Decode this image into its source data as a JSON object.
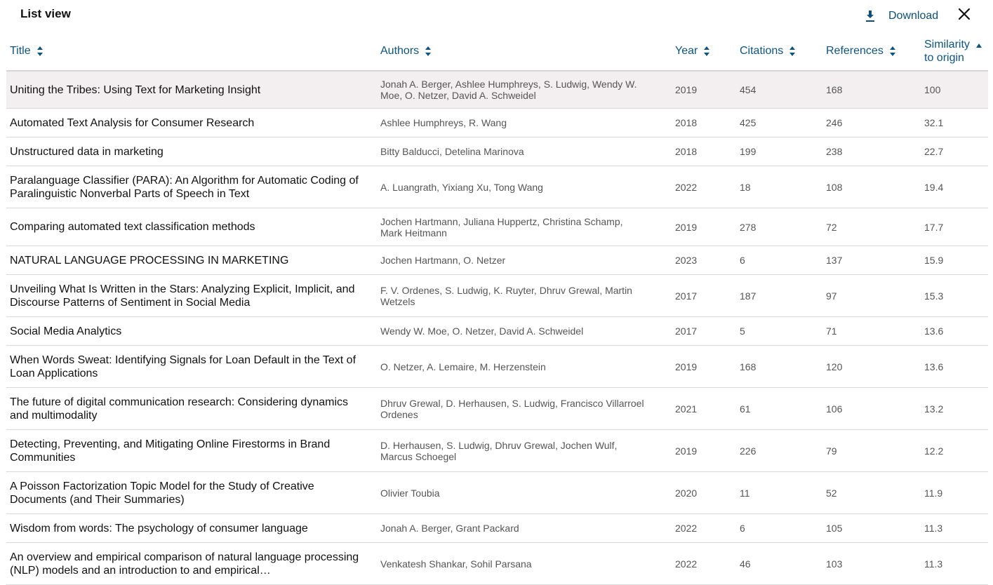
{
  "header": {
    "title": "List view",
    "download_label": "Download",
    "accent": "#0b5484"
  },
  "columns": {
    "title": "Title",
    "authors": "Authors",
    "year": "Year",
    "citations": "Citations",
    "references": "References",
    "similarity_line1": "Similarity",
    "similarity_line2": "to origin"
  },
  "rows": [
    {
      "title": "Uniting the Tribes: Using Text for Marketing Insight",
      "authors": "Jonah A. Berger, Ashlee Humphreys, S. Ludwig, Wendy W. Moe, O. Netzer, David A. Schweidel",
      "year": "2019",
      "citations": "454",
      "references": "168",
      "similarity": "100"
    },
    {
      "title": "Automated Text Analysis for Consumer Research",
      "authors": "Ashlee Humphreys, R. Wang",
      "year": "2018",
      "citations": "425",
      "references": "246",
      "similarity": "32.1"
    },
    {
      "title": "Unstructured data in marketing",
      "authors": "Bitty Balducci, Detelina Marinova",
      "year": "2018",
      "citations": "199",
      "references": "238",
      "similarity": "22.7"
    },
    {
      "title": "Paralanguage Classifier (PARA): An Algorithm for Automatic Coding of Paralinguistic Nonverbal Parts of Speech in Text",
      "authors": "A. Luangrath, Yixiang Xu, Tong Wang",
      "year": "2022",
      "citations": "18",
      "references": "108",
      "similarity": "19.4"
    },
    {
      "title": "Comparing automated text classification methods",
      "authors": "Jochen Hartmann, Juliana Huppertz, Christina Schamp, Mark Heitmann",
      "year": "2019",
      "citations": "278",
      "references": "72",
      "similarity": "17.7"
    },
    {
      "title": "NATURAL LANGUAGE PROCESSING IN MARKETING",
      "authors": "Jochen Hartmann, O. Netzer",
      "year": "2023",
      "citations": "6",
      "references": "137",
      "similarity": "15.9"
    },
    {
      "title": "Unveiling What Is Written in the Stars: Analyzing Explicit, Implicit, and Discourse Patterns of Sentiment in Social Media",
      "authors": "F. V. Ordenes, S. Ludwig, K. Ruyter, Dhruv Grewal, Martin Wetzels",
      "year": "2017",
      "citations": "187",
      "references": "97",
      "similarity": "15.3"
    },
    {
      "title": "Social Media Analytics",
      "authors": "Wendy W. Moe, O. Netzer, David A. Schweidel",
      "year": "2017",
      "citations": "5",
      "references": "71",
      "similarity": "13.6"
    },
    {
      "title": "When Words Sweat: Identifying Signals for Loan Default in the Text of Loan Applications",
      "authors": "O. Netzer, A. Lemaire, M. Herzenstein",
      "year": "2019",
      "citations": "168",
      "references": "120",
      "similarity": "13.6"
    },
    {
      "title": "The future of digital communication research: Considering dynamics and multimodality",
      "authors": "Dhruv Grewal, D. Herhausen, S. Ludwig, Francisco Villarroel Ordenes",
      "year": "2021",
      "citations": "61",
      "references": "106",
      "similarity": "13.2"
    },
    {
      "title": "Detecting, Preventing, and Mitigating Online Firestorms in Brand Communities",
      "authors": "D. Herhausen, S. Ludwig, Dhruv Grewal, Jochen Wulf, Marcus Schoegel",
      "year": "2019",
      "citations": "226",
      "references": "79",
      "similarity": "12.2"
    },
    {
      "title": "A Poisson Factorization Topic Model for the Study of Creative Documents (and Their Summaries)",
      "authors": "Olivier Toubia",
      "year": "2020",
      "citations": "11",
      "references": "52",
      "similarity": "11.9"
    },
    {
      "title": "Wisdom from words: The psychology of consumer language",
      "authors": "Jonah A. Berger, Grant Packard",
      "year": "2022",
      "citations": "6",
      "references": "105",
      "similarity": "11.3"
    },
    {
      "title": "An overview and empirical comparison of natural language processing (NLP) models and an introduction to and empirical…",
      "authors": "Venkatesh Shankar, Sohil Parsana",
      "year": "2022",
      "citations": "46",
      "references": "103",
      "similarity": "11.3"
    }
  ]
}
